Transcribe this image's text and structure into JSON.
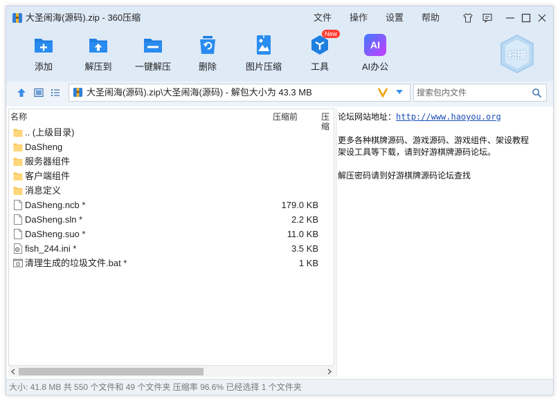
{
  "window": {
    "title": "大圣闹海(源码).zip - 360压缩",
    "menu": [
      "文件",
      "操作",
      "设置",
      "帮助"
    ]
  },
  "toolbar": {
    "items": [
      {
        "label": "添加",
        "icon": "add-icon"
      },
      {
        "label": "解压到",
        "icon": "extract-to-icon"
      },
      {
        "label": "一键解压",
        "icon": "one-click-extract-icon"
      },
      {
        "label": "删除",
        "icon": "delete-icon"
      },
      {
        "label": "图片压缩",
        "icon": "image-compress-icon"
      },
      {
        "label": "工具",
        "icon": "tools-icon"
      },
      {
        "label": "AI办公",
        "icon": "ai-office-icon"
      }
    ],
    "new_badge": "New",
    "scan_label": "扫描",
    "ai_text": "AI"
  },
  "address": {
    "path": "大圣闹海(源码).zip\\大圣闹海(源码) - 解包大小为 43.3 MB",
    "search_placeholder": "搜索包内文件"
  },
  "filelist": {
    "columns": {
      "name": "名称",
      "size_before": "压缩前",
      "size_after": "压缩"
    },
    "rows": [
      {
        "name": ".. (上级目录)",
        "size": "",
        "type": "folder"
      },
      {
        "name": "DaSheng",
        "size": "",
        "type": "folder"
      },
      {
        "name": "服务器组件",
        "size": "",
        "type": "folder"
      },
      {
        "name": "客户端组件",
        "size": "",
        "type": "folder"
      },
      {
        "name": "消息定义",
        "size": "",
        "type": "folder"
      },
      {
        "name": "DaSheng.ncb *",
        "size": "179.0 KB",
        "type": "file"
      },
      {
        "name": "DaSheng.sln *",
        "size": "2.2 KB",
        "type": "file"
      },
      {
        "name": "DaSheng.suo *",
        "size": "11.0 KB",
        "type": "file"
      },
      {
        "name": "fish_244.ini *",
        "size": "3.5 KB",
        "type": "ini"
      },
      {
        "name": "清理生成的垃圾文件.bat *",
        "size": "1 KB",
        "type": "bat"
      }
    ]
  },
  "comment": {
    "line1_label": "论坛网站地址：",
    "line1_link": "http://www.haoyou.org",
    "line2": "更多各种棋牌源码、游戏源码、游戏组件、架设教程",
    "line3": "架设工具等下载，请到好游棋牌源码论坛。",
    "line4": "解压密码请到好游棋牌源码论坛查找"
  },
  "status": {
    "text": "大小: 41.8 MB 共 550 个文件和 49 个文件夹 压缩率 96.6% 已经选择 1 个文件夹"
  },
  "colors": {
    "toolbar_bg": "#dfeaf7",
    "accent_blue": "#1f7fe0",
    "new_badge": "#ff3b30"
  }
}
